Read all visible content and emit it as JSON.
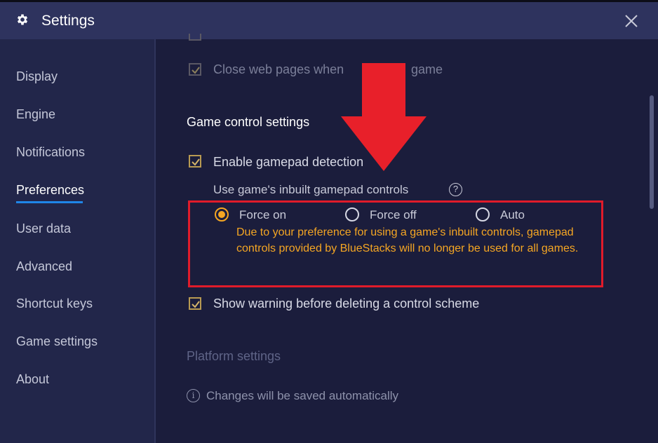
{
  "window": {
    "title": "Settings",
    "icons": {
      "settings": "gear-icon",
      "close": "close-icon"
    }
  },
  "sidebar": {
    "items": [
      {
        "label": "Display"
      },
      {
        "label": "Engine"
      },
      {
        "label": "Notifications"
      },
      {
        "label": "Preferences",
        "active": true
      },
      {
        "label": "User data"
      },
      {
        "label": "Advanced"
      },
      {
        "label": "Shortcut keys"
      },
      {
        "label": "Game settings"
      },
      {
        "label": "About"
      }
    ]
  },
  "preferences": {
    "close_web_pages": {
      "label": "Close web pages when",
      "label_end": "game",
      "checked": true
    },
    "game_control": {
      "header": "Game control settings",
      "enable_gamepad": {
        "label": "Enable gamepad detection",
        "checked": true
      },
      "inbuilt_controls": {
        "label": "Use game's inbuilt gamepad controls",
        "help_icon": "?",
        "options": [
          {
            "label": "Force on",
            "selected": true
          },
          {
            "label": "Force off",
            "selected": false
          },
          {
            "label": "Auto",
            "selected": false
          }
        ],
        "warning": "Due to your preference for using a game's inbuilt controls, gamepad controls provided by BlueStacks will no longer be used for all games."
      },
      "show_warning": {
        "label": "Show warning before deleting a control scheme",
        "checked": true
      }
    },
    "platform": {
      "header": "Platform settings"
    },
    "footer": {
      "info_icon": "i",
      "note": "Changes will be saved automatically"
    }
  },
  "colors": {
    "titlebar": "#2e335e",
    "sidebar": "#22264a",
    "content": "#1b1d3c",
    "accent_underline": "#1f86e8",
    "warning": "#f5a623",
    "highlight": "#e01b2a"
  }
}
